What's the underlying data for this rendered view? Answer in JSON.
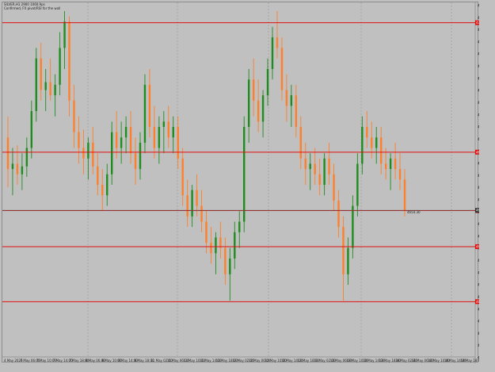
{
  "header": {
    "line1": "SILVER,H1  2900  1060.9ps",
    "line2": "Confirmed, FX pivot/RSI for the wall"
  },
  "colors": {
    "background": "#c0c0c0",
    "bull": "#1e8c1e",
    "bear": "#ff7f2a",
    "level": "#e01010",
    "grid": "#9a9a9a"
  },
  "y_axis": {
    "ticks": [
      "4732.10",
      "4727.55",
      "4722.85",
      "4718.30",
      "4713.60",
      "4709.05",
      "4704.40",
      "4699.80",
      "4695.10",
      "4690.55",
      "4685.90",
      "4681.30",
      "4676.70",
      "4672.10",
      "4667.40",
      "4662.85",
      "4658.20",
      "4653.60",
      "4648.95",
      "4644.35",
      "4639.80",
      "4635.10",
      "4630.55",
      "4625.90",
      "4621.35",
      "4616.70",
      "4612.10",
      "4607.55",
      "4602.90",
      "4598.30"
    ],
    "max": 4732.1,
    "min": 4598.3
  },
  "x_axis": {
    "ticks": [
      "4 May 2026",
      "7 May 06:00",
      "7 May 10:00",
      "7 May 14:00",
      "7 May 18:00",
      "8 May 06:00",
      "8 May 10:00",
      "8 May 14:00",
      "8 May 18:00",
      "11 May 02:00",
      "11 May 06:00",
      "11 May 10:00",
      "11 May 14:00",
      "11 May 18:00",
      "12 May 02:00",
      "12 May 06:00",
      "12 May 10:00",
      "12 May 14:00",
      "12 May 18:00",
      "13 May 02:00",
      "13 May 06:00",
      "13 May 10:00",
      "13 May 14:00",
      "13 May 18:00",
      "14 May 02:00",
      "14 May 06:00",
      "14 May 10:00",
      "14 May 14:00",
      "14 May 18:00"
    ]
  },
  "levels": [
    {
      "price": 4725.6,
      "label": "4725.60"
    },
    {
      "price": 4676.4,
      "label": "4676.40"
    },
    {
      "price": 4654.2,
      "label": "4654.20"
    },
    {
      "price": 4640.5,
      "label": "4640.50"
    },
    {
      "price": 4619.6,
      "label": "4619.60"
    }
  ],
  "current": {
    "price": 4654.3,
    "label": "4654.30",
    "bid_label": "4654.30"
  },
  "chart_data": {
    "type": "candlestick",
    "series": [
      {
        "values": [
          {
            "o": 4682,
            "h": 4690,
            "l": 4663,
            "c": 4670
          },
          {
            "o": 4670,
            "h": 4678,
            "l": 4660,
            "c": 4672
          },
          {
            "o": 4672,
            "h": 4679,
            "l": 4664,
            "c": 4668
          },
          {
            "o": 4668,
            "h": 4676,
            "l": 4662,
            "c": 4671
          },
          {
            "o": 4671,
            "h": 4682,
            "l": 4667,
            "c": 4678
          },
          {
            "o": 4678,
            "h": 4696,
            "l": 4674,
            "c": 4692
          },
          {
            "o": 4692,
            "h": 4716,
            "l": 4688,
            "c": 4712
          },
          {
            "o": 4712,
            "h": 4718,
            "l": 4696,
            "c": 4700
          },
          {
            "o": 4700,
            "h": 4708,
            "l": 4692,
            "c": 4703
          },
          {
            "o": 4703,
            "h": 4712,
            "l": 4696,
            "c": 4698
          },
          {
            "o": 4698,
            "h": 4706,
            "l": 4690,
            "c": 4702
          },
          {
            "o": 4702,
            "h": 4722,
            "l": 4698,
            "c": 4716
          },
          {
            "o": 4716,
            "h": 4730,
            "l": 4708,
            "c": 4726
          },
          {
            "o": 4726,
            "h": 4728,
            "l": 4690,
            "c": 4696
          },
          {
            "o": 4696,
            "h": 4702,
            "l": 4678,
            "c": 4684
          },
          {
            "o": 4684,
            "h": 4690,
            "l": 4672,
            "c": 4678
          },
          {
            "o": 4678,
            "h": 4685,
            "l": 4668,
            "c": 4674
          },
          {
            "o": 4674,
            "h": 4682,
            "l": 4666,
            "c": 4680
          },
          {
            "o": 4680,
            "h": 4686,
            "l": 4668,
            "c": 4671
          },
          {
            "o": 4671,
            "h": 4676,
            "l": 4660,
            "c": 4664
          },
          {
            "o": 4664,
            "h": 4670,
            "l": 4654,
            "c": 4660
          },
          {
            "o": 4660,
            "h": 4672,
            "l": 4656,
            "c": 4668
          },
          {
            "o": 4668,
            "h": 4688,
            "l": 4664,
            "c": 4684
          },
          {
            "o": 4684,
            "h": 4692,
            "l": 4674,
            "c": 4678
          },
          {
            "o": 4678,
            "h": 4688,
            "l": 4672,
            "c": 4682
          },
          {
            "o": 4682,
            "h": 4690,
            "l": 4676,
            "c": 4686
          },
          {
            "o": 4686,
            "h": 4692,
            "l": 4672,
            "c": 4676
          },
          {
            "o": 4676,
            "h": 4682,
            "l": 4664,
            "c": 4670
          },
          {
            "o": 4670,
            "h": 4684,
            "l": 4666,
            "c": 4680
          },
          {
            "o": 4680,
            "h": 4706,
            "l": 4676,
            "c": 4702
          },
          {
            "o": 4702,
            "h": 4708,
            "l": 4682,
            "c": 4686
          },
          {
            "o": 4686,
            "h": 4694,
            "l": 4674,
            "c": 4678
          },
          {
            "o": 4678,
            "h": 4690,
            "l": 4672,
            "c": 4686
          },
          {
            "o": 4686,
            "h": 4692,
            "l": 4676,
            "c": 4688
          },
          {
            "o": 4688,
            "h": 4694,
            "l": 4678,
            "c": 4682
          },
          {
            "o": 4682,
            "h": 4690,
            "l": 4676,
            "c": 4686
          },
          {
            "o": 4686,
            "h": 4690,
            "l": 4670,
            "c": 4674
          },
          {
            "o": 4674,
            "h": 4678,
            "l": 4656,
            "c": 4660
          },
          {
            "o": 4660,
            "h": 4666,
            "l": 4648,
            "c": 4652
          },
          {
            "o": 4652,
            "h": 4664,
            "l": 4648,
            "c": 4662
          },
          {
            "o": 4662,
            "h": 4668,
            "l": 4652,
            "c": 4656
          },
          {
            "o": 4656,
            "h": 4662,
            "l": 4646,
            "c": 4650
          },
          {
            "o": 4650,
            "h": 4654,
            "l": 4638,
            "c": 4642
          },
          {
            "o": 4642,
            "h": 4648,
            "l": 4634,
            "c": 4638
          },
          {
            "o": 4638,
            "h": 4646,
            "l": 4630,
            "c": 4644
          },
          {
            "o": 4644,
            "h": 4650,
            "l": 4636,
            "c": 4640
          },
          {
            "o": 4640,
            "h": 4644,
            "l": 4626,
            "c": 4630
          },
          {
            "o": 4630,
            "h": 4640,
            "l": 4620,
            "c": 4636
          },
          {
            "o": 4636,
            "h": 4650,
            "l": 4632,
            "c": 4646
          },
          {
            "o": 4646,
            "h": 4654,
            "l": 4640,
            "c": 4650
          },
          {
            "o": 4650,
            "h": 4690,
            "l": 4646,
            "c": 4686
          },
          {
            "o": 4686,
            "h": 4708,
            "l": 4680,
            "c": 4704
          },
          {
            "o": 4704,
            "h": 4712,
            "l": 4690,
            "c": 4696
          },
          {
            "o": 4696,
            "h": 4704,
            "l": 4684,
            "c": 4688
          },
          {
            "o": 4688,
            "h": 4700,
            "l": 4682,
            "c": 4698
          },
          {
            "o": 4698,
            "h": 4712,
            "l": 4694,
            "c": 4708
          },
          {
            "o": 4708,
            "h": 4724,
            "l": 4704,
            "c": 4720
          },
          {
            "o": 4720,
            "h": 4730,
            "l": 4712,
            "c": 4716
          },
          {
            "o": 4716,
            "h": 4720,
            "l": 4696,
            "c": 4700
          },
          {
            "o": 4700,
            "h": 4706,
            "l": 4688,
            "c": 4694
          },
          {
            "o": 4694,
            "h": 4702,
            "l": 4686,
            "c": 4698
          },
          {
            "o": 4698,
            "h": 4702,
            "l": 4682,
            "c": 4686
          },
          {
            "o": 4686,
            "h": 4690,
            "l": 4670,
            "c": 4674
          },
          {
            "o": 4674,
            "h": 4680,
            "l": 4664,
            "c": 4670
          },
          {
            "o": 4670,
            "h": 4676,
            "l": 4662,
            "c": 4672
          },
          {
            "o": 4672,
            "h": 4678,
            "l": 4664,
            "c": 4668
          },
          {
            "o": 4668,
            "h": 4674,
            "l": 4660,
            "c": 4664
          },
          {
            "o": 4664,
            "h": 4676,
            "l": 4660,
            "c": 4674
          },
          {
            "o": 4674,
            "h": 4680,
            "l": 4664,
            "c": 4668
          },
          {
            "o": 4668,
            "h": 4672,
            "l": 4654,
            "c": 4658
          },
          {
            "o": 4658,
            "h": 4662,
            "l": 4644,
            "c": 4648
          },
          {
            "o": 4648,
            "h": 4652,
            "l": 4620,
            "c": 4630
          },
          {
            "o": 4630,
            "h": 4644,
            "l": 4626,
            "c": 4640
          },
          {
            "o": 4640,
            "h": 4660,
            "l": 4636,
            "c": 4656
          },
          {
            "o": 4656,
            "h": 4676,
            "l": 4652,
            "c": 4672
          },
          {
            "o": 4672,
            "h": 4690,
            "l": 4668,
            "c": 4686
          },
          {
            "o": 4686,
            "h": 4692,
            "l": 4678,
            "c": 4682
          },
          {
            "o": 4682,
            "h": 4688,
            "l": 4674,
            "c": 4678
          },
          {
            "o": 4678,
            "h": 4686,
            "l": 4672,
            "c": 4682
          },
          {
            "o": 4682,
            "h": 4686,
            "l": 4668,
            "c": 4672
          },
          {
            "o": 4672,
            "h": 4678,
            "l": 4666,
            "c": 4670
          },
          {
            "o": 4670,
            "h": 4676,
            "l": 4662,
            "c": 4674
          },
          {
            "o": 4674,
            "h": 4680,
            "l": 4666,
            "c": 4670
          },
          {
            "o": 4670,
            "h": 4676,
            "l": 4662,
            "c": 4666
          },
          {
            "o": 4666,
            "h": 4670,
            "l": 4652,
            "c": 4654
          }
        ]
      }
    ]
  }
}
